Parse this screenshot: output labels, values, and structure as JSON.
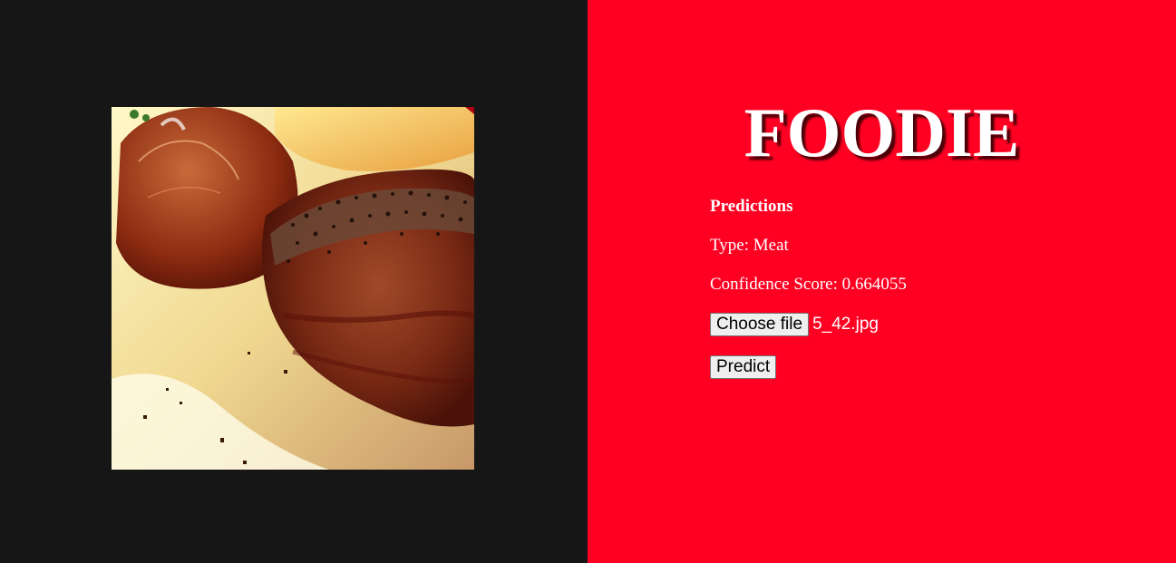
{
  "app": {
    "title": "FOODIE"
  },
  "predictions": {
    "heading": "Predictions",
    "type_text": "Type: Meat",
    "confidence_text": "Confidence Score: 0.664055"
  },
  "upload": {
    "choose_file_label": "Choose file",
    "selected_file": "5_42.jpg"
  },
  "actions": {
    "predict_label": "Predict"
  },
  "colors": {
    "left_background": "#161616",
    "right_background": "#ff0022",
    "text": "#ffffff"
  }
}
